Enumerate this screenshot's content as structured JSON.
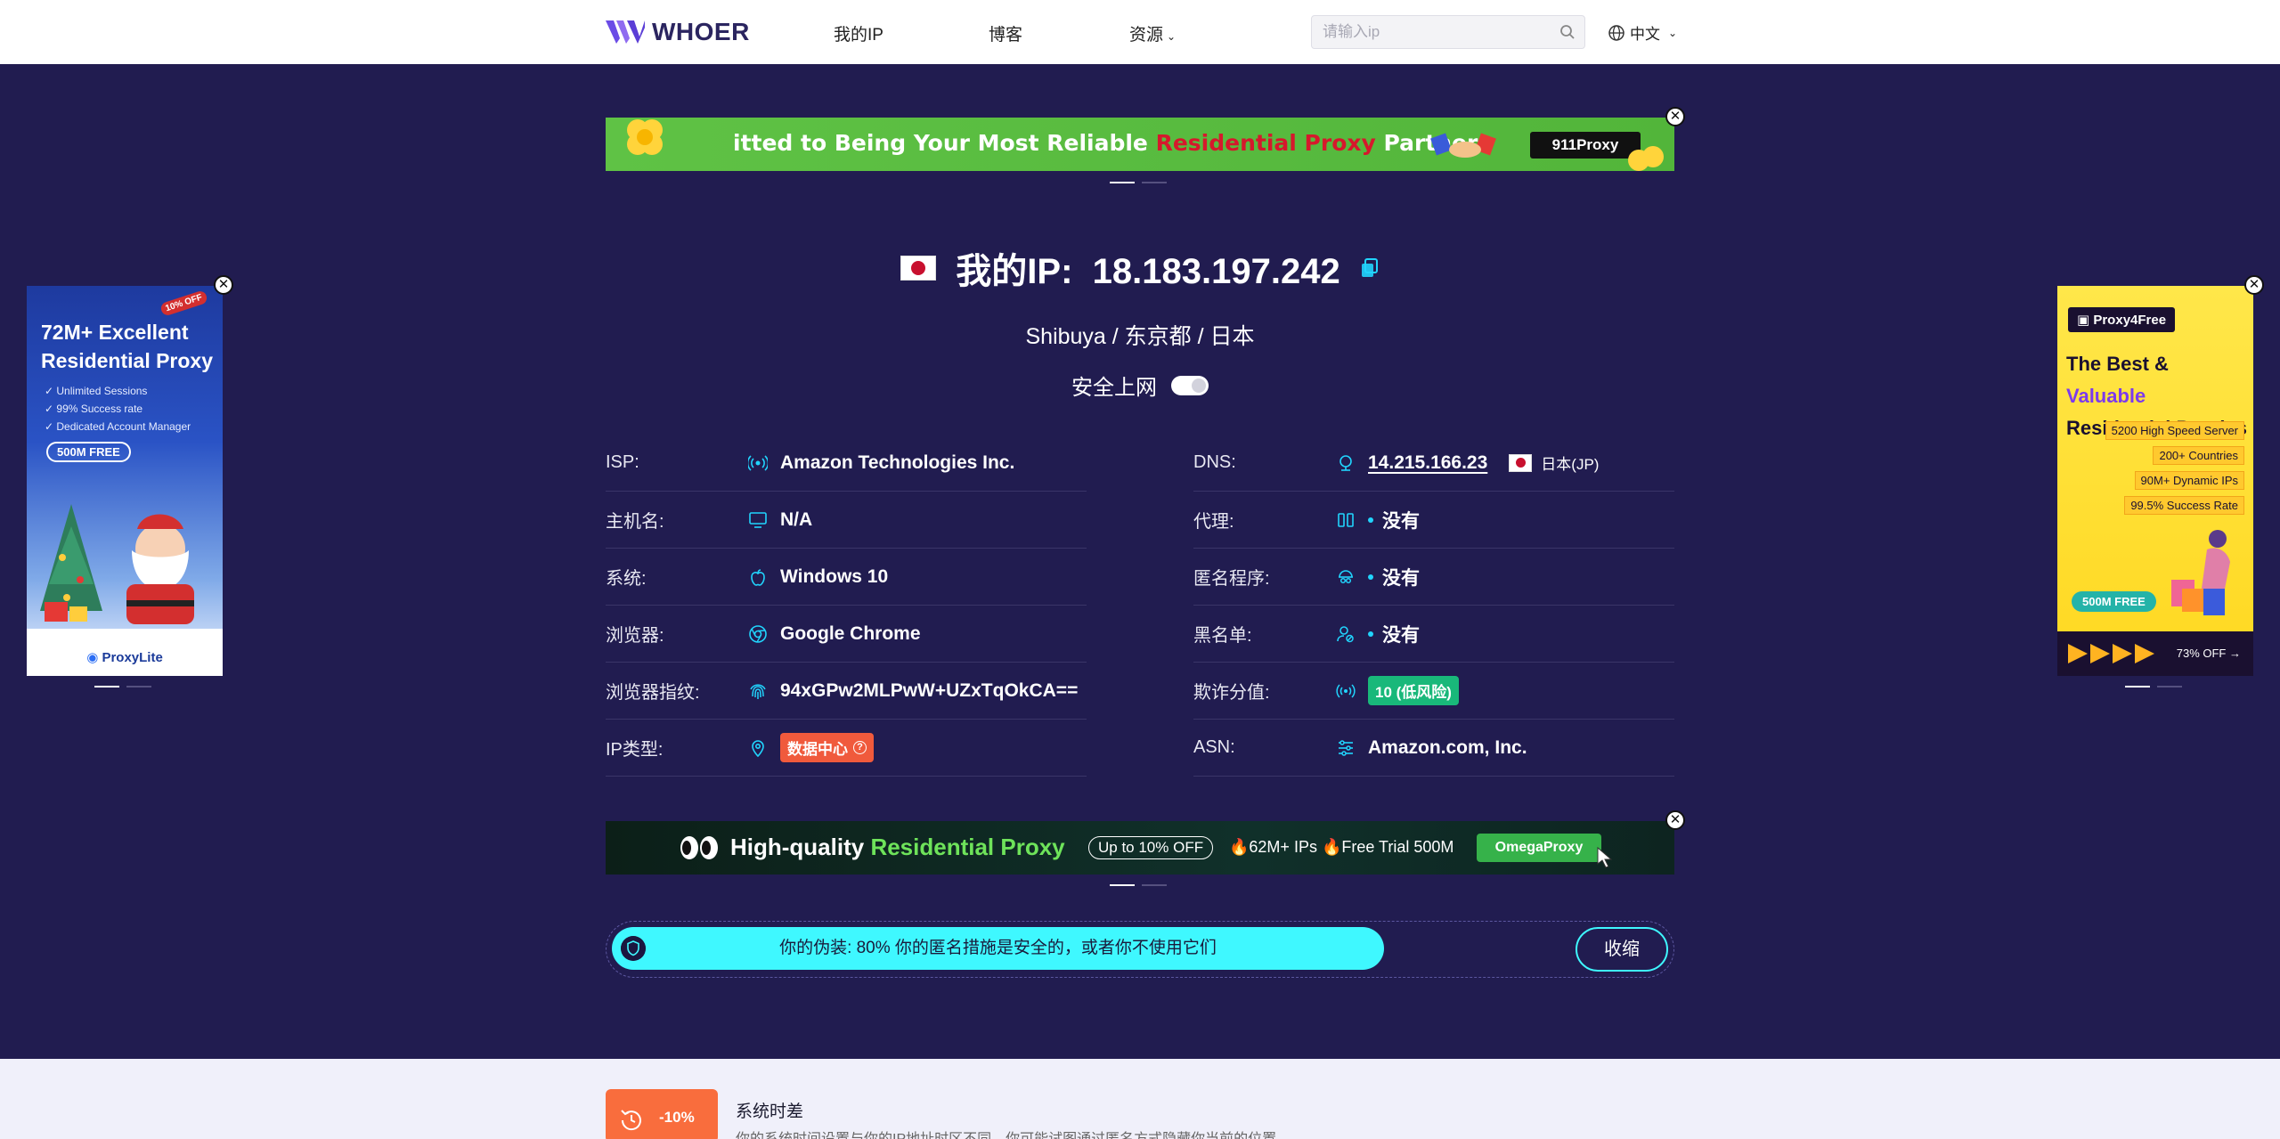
{
  "header": {
    "brand": "WHOER",
    "nav": [
      {
        "label": "我的IP"
      },
      {
        "label": "博客"
      },
      {
        "label": "资源"
      }
    ],
    "search_placeholder": "请输入ip",
    "language": "中文"
  },
  "top_banner": {
    "text_before": "itted to Being Your Most Reliable ",
    "text_highlight": "Residential Proxy",
    "text_after": " Partner",
    "brand": "911Proxy"
  },
  "ip_block": {
    "label": "我的IP:",
    "ip": "18.183.197.242",
    "location": "Shibuya / 东京都 / 日本",
    "safe_label": "安全上网"
  },
  "info_left": [
    {
      "label": "ISP:",
      "value": "Amazon Technologies Inc.",
      "icon": "broadcast-icon"
    },
    {
      "label": "主机名:",
      "value": "N/A",
      "icon": "monitor-icon"
    },
    {
      "label": "系统:",
      "value": "Windows 10",
      "icon": "apple-icon"
    },
    {
      "label": "浏览器:",
      "value": "Google Chrome",
      "icon": "chrome-icon"
    },
    {
      "label": "浏览器指纹:",
      "value": "94xGPw2MLPwW+UZxTqOkCA==",
      "icon": "fingerprint-icon"
    },
    {
      "label": "IP类型:",
      "value": "数据中心",
      "icon": "location-pin-icon"
    }
  ],
  "info_right": [
    {
      "label": "DNS:",
      "value": "14.215.166.23",
      "extra": "日本(JP)",
      "icon": "dns-icon"
    },
    {
      "label": "代理:",
      "value": "没有",
      "icon": "proxy-icon"
    },
    {
      "label": "匿名程序:",
      "value": "没有",
      "icon": "anonymizer-icon"
    },
    {
      "label": "黑名单:",
      "value": "没有",
      "icon": "blacklist-user-icon"
    },
    {
      "label": "欺诈分值:",
      "value": "10 (低风险)",
      "icon": "signal-icon"
    },
    {
      "label": "ASN:",
      "value": "Amazon.com, Inc.",
      "icon": "sliders-icon"
    }
  ],
  "bottom_banner": {
    "text_before": "High-quality ",
    "text_highlight": "Residential Proxy",
    "offer": "Up to 10% OFF",
    "extra": "🔥62M+ IPs  🔥Free Trial 500M",
    "brand": "OmegaProxy"
  },
  "disguise": {
    "text": "你的伪装: 80% 你的匿名措施是安全的，或者你不使用它们",
    "collapse_label": "收缩"
  },
  "ad_left": {
    "title": "72M+ Excellent Residential Proxy",
    "features": [
      "Unlimited Sessions",
      "99% Success rate",
      "Dedicated Account Manager"
    ],
    "free": "500M FREE",
    "brand": "ProxyLite",
    "sale_tag": "10% OFF"
  },
  "ad_right": {
    "brand": "Proxy4Free",
    "title_start": "The Best & ",
    "title_highlight": "Valuable",
    "title_end": " Residential Proxies",
    "features": [
      "5200 High Speed Server",
      "200+ Countries",
      "90M+ Dynamic IPs",
      "99.5% Success Rate"
    ],
    "free": "500M FREE",
    "discount": "73% OFF →"
  },
  "system_time": {
    "badge": "-10%",
    "title": "系统时差",
    "desc": "你的系统时间设置与你的IP地址时区不同，你可能试图通过匿名方式隐藏你当前的位置"
  },
  "colors": {
    "hero_bg": "#211c50",
    "accent_cyan": "#3ff8ff",
    "badge_green": "#19b87a",
    "badge_red": "#f05a3c"
  }
}
